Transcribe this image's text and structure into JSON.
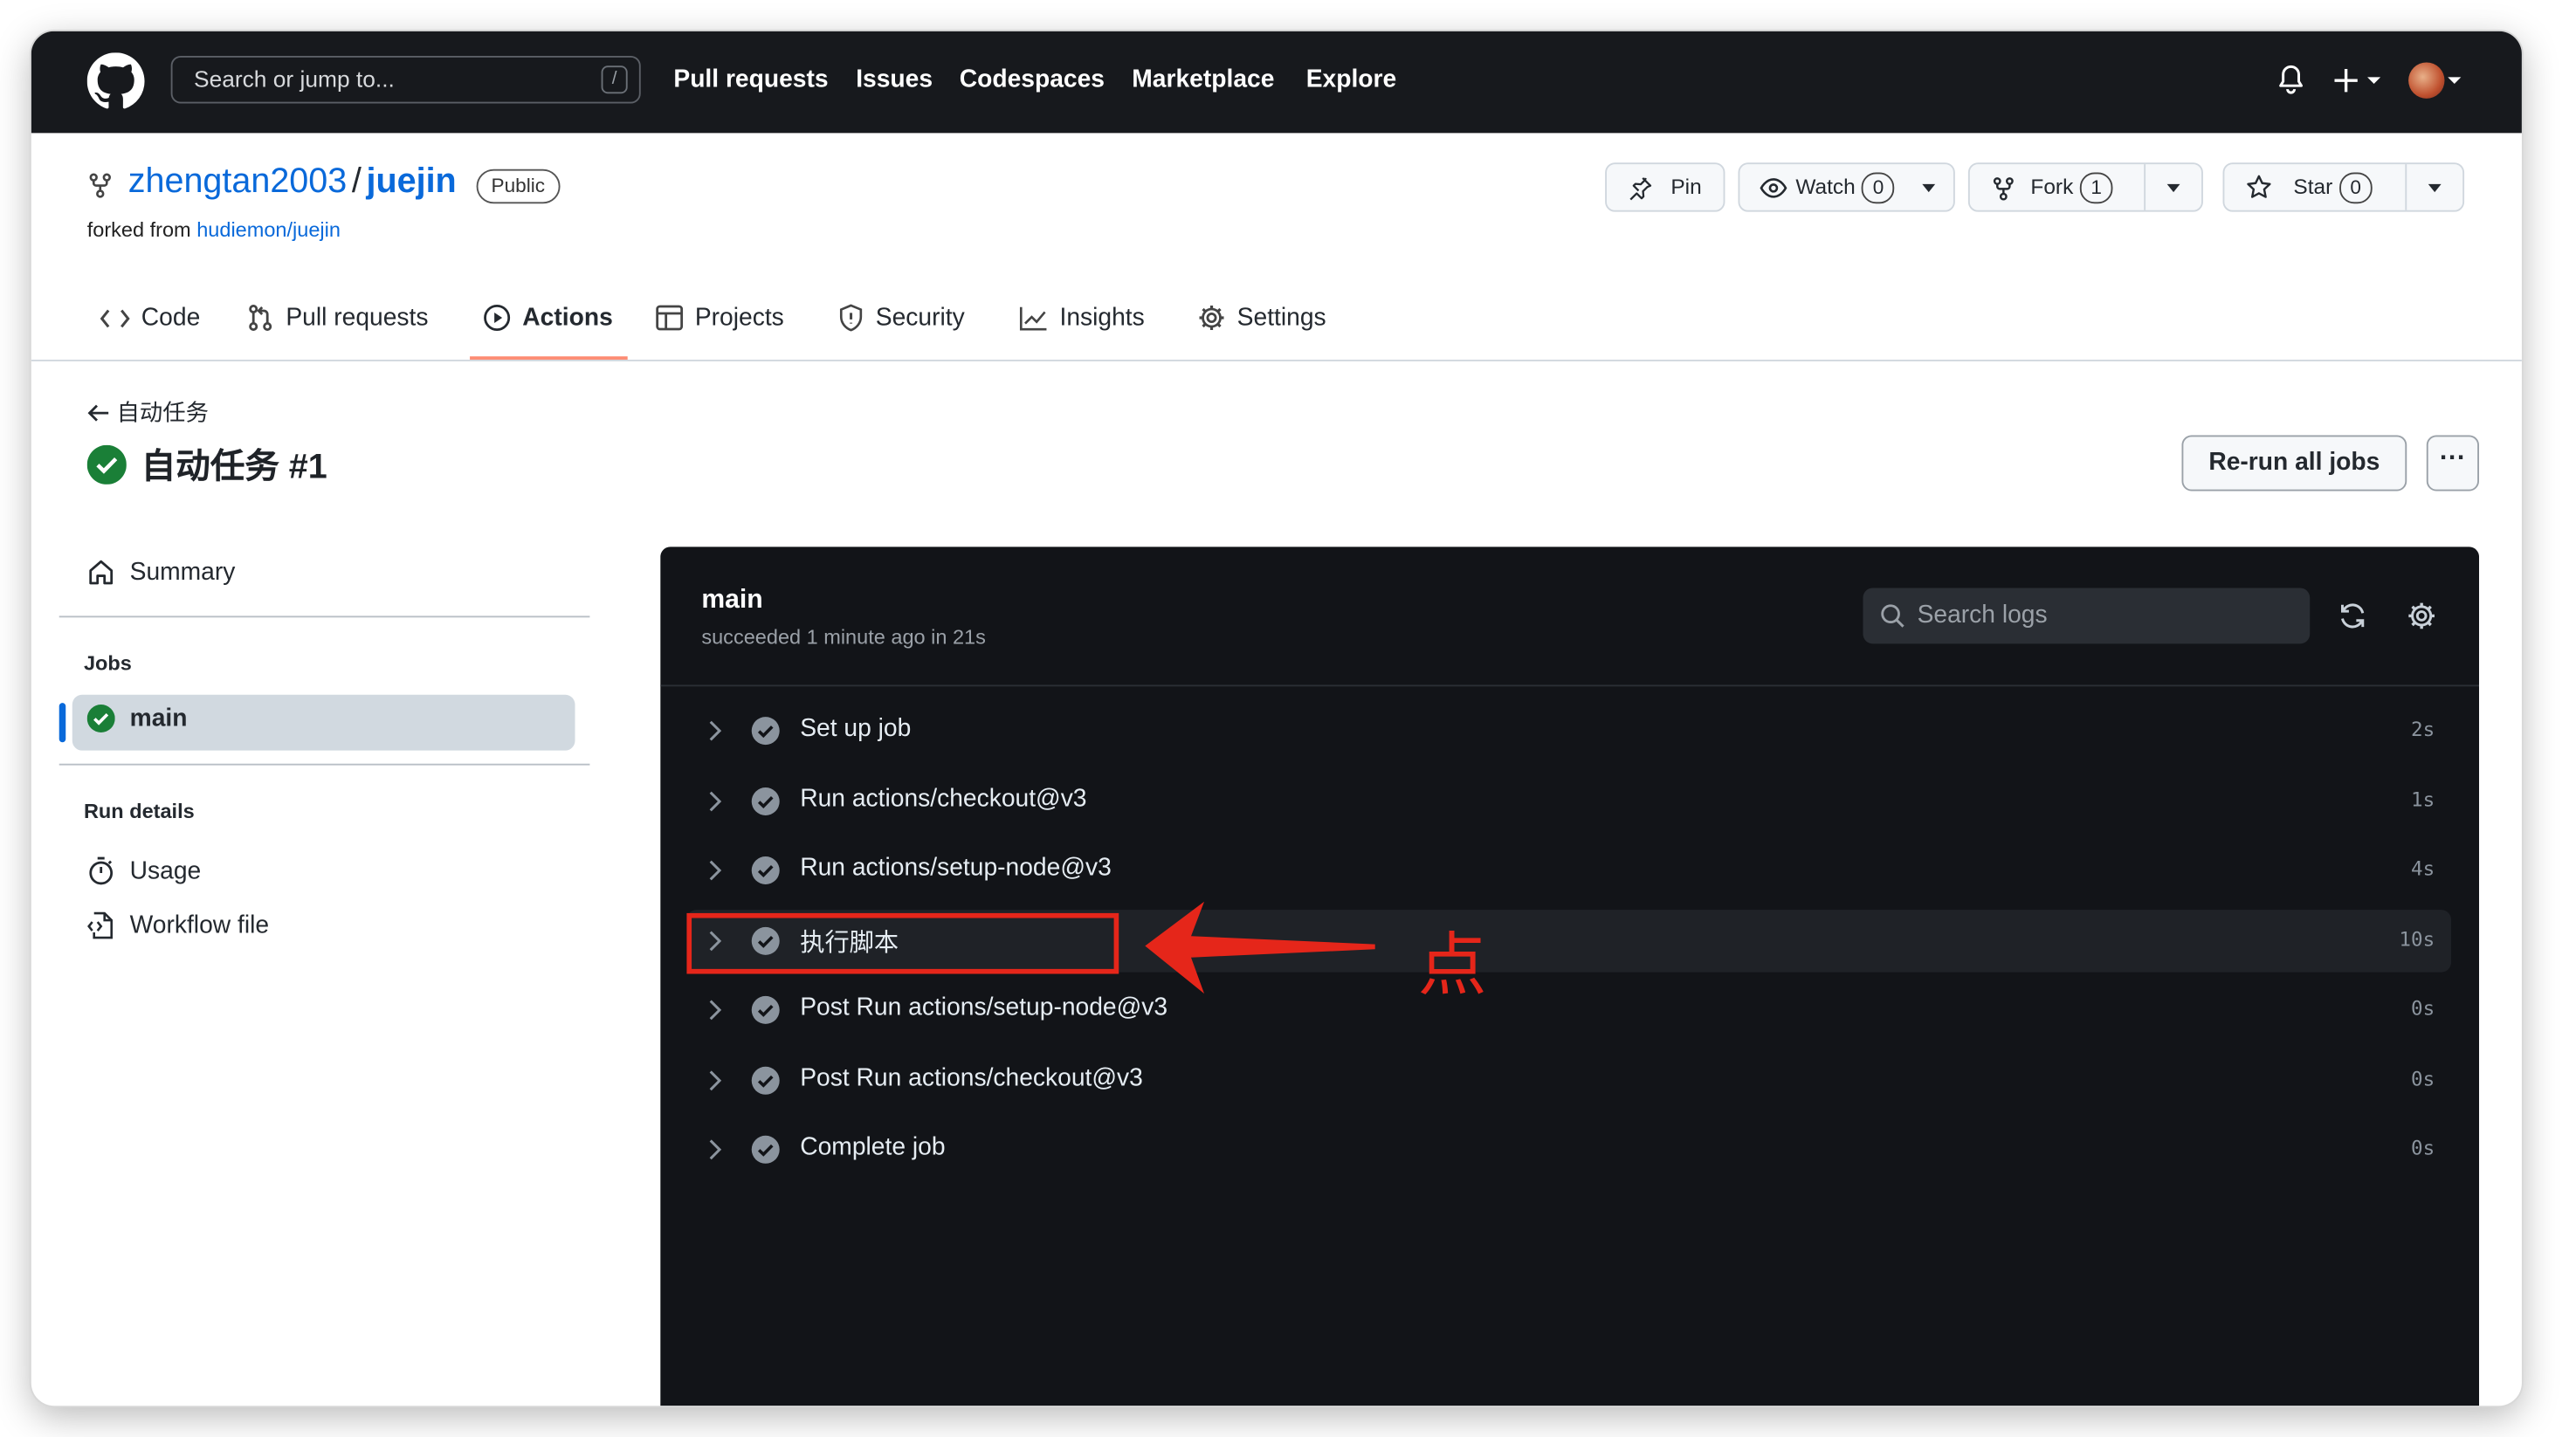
{
  "header": {
    "search_placeholder": "Search or jump to...",
    "search_key": "/",
    "nav": [
      "Pull requests",
      "Issues",
      "Codespaces",
      "Marketplace",
      "Explore"
    ]
  },
  "repo": {
    "owner": "zhengtan2003",
    "separator": "/",
    "name": "juejin",
    "visibility": "Public",
    "forked_prefix": "forked from",
    "forked_from": "hudiemon/juejin",
    "pin_label": "Pin",
    "watch_label": "Watch",
    "watch_count": "0",
    "fork_label": "Fork",
    "fork_count": "1",
    "star_label": "Star",
    "star_count": "0"
  },
  "tabs": {
    "code": "Code",
    "pulls": "Pull requests",
    "actions": "Actions",
    "projects": "Projects",
    "security": "Security",
    "insights": "Insights",
    "settings": "Settings"
  },
  "run": {
    "back_label": "自动任务",
    "title": "自动任务 #1",
    "rerun_label": "Re-run all jobs",
    "more_label": "···"
  },
  "sidebar": {
    "summary": "Summary",
    "jobs_heading": "Jobs",
    "job_main": "main",
    "run_details_heading": "Run details",
    "usage": "Usage",
    "workflow_file": "Workflow file"
  },
  "log": {
    "job_name": "main",
    "status": "succeeded 1 minute ago in 21s",
    "search_placeholder": "Search logs",
    "steps": [
      {
        "label": "Set up job",
        "duration": "2s"
      },
      {
        "label": "Run actions/checkout@v3",
        "duration": "1s"
      },
      {
        "label": "Run actions/setup-node@v3",
        "duration": "4s"
      },
      {
        "label": "执行脚本",
        "duration": "10s"
      },
      {
        "label": "Post Run actions/setup-node@v3",
        "duration": "0s"
      },
      {
        "label": "Post Run actions/checkout@v3",
        "duration": "0s"
      },
      {
        "label": "Complete job",
        "duration": "0s"
      }
    ]
  },
  "annotation": {
    "text": "点",
    "color": "#e5261a"
  },
  "colors": {
    "header_bg": "#17191d",
    "link": "#0969da",
    "success": "#1a7f37",
    "tab_underline": "#fd8c73",
    "log_bg": "#121418"
  }
}
